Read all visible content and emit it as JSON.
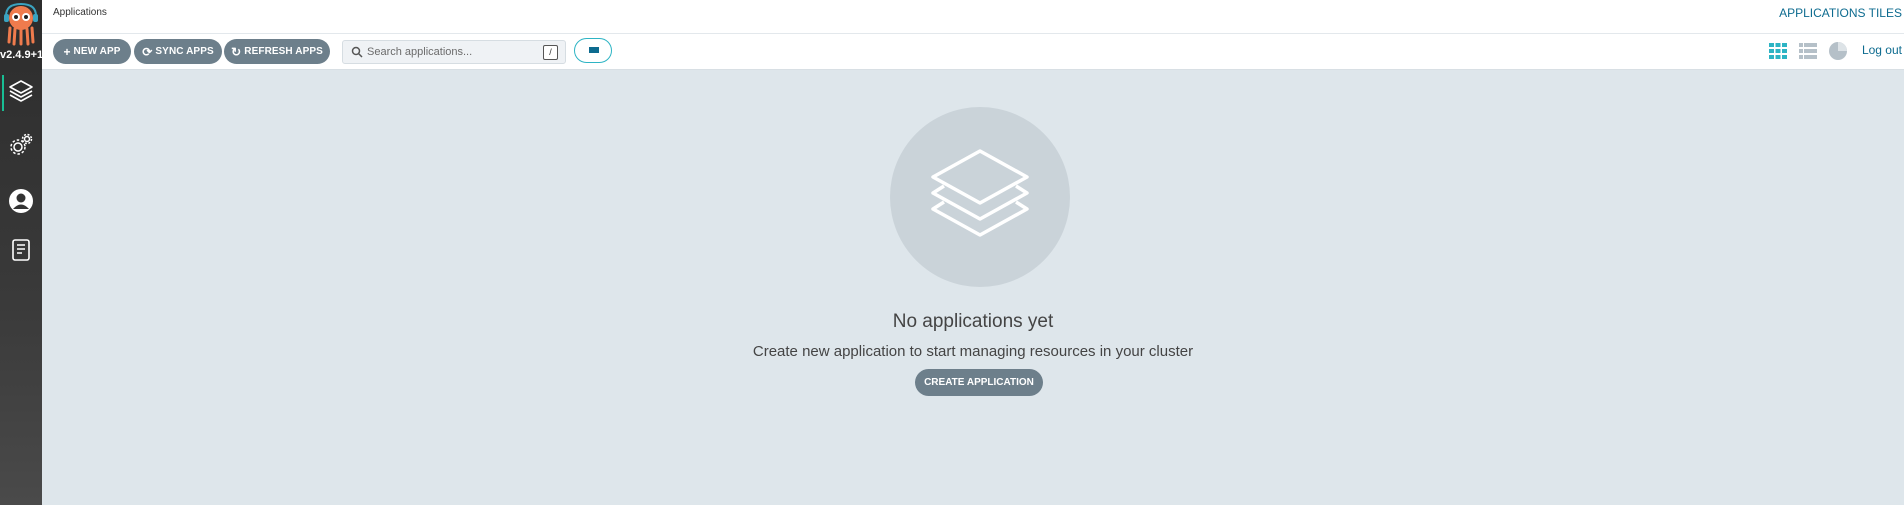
{
  "sidebar": {
    "version": "v2.4.9+1",
    "logo": "argo-octopus-logo",
    "items": [
      {
        "name": "applications",
        "icon": "layers-icon",
        "active": true
      },
      {
        "name": "settings",
        "icon": "gears-icon",
        "active": false
      },
      {
        "name": "user-info",
        "icon": "user-circle-icon",
        "active": false
      },
      {
        "name": "documentation",
        "icon": "book-icon",
        "active": false
      }
    ]
  },
  "topbar": {
    "breadcrumb": "Applications",
    "title": "APPLICATIONS TILES"
  },
  "toolbar": {
    "new_app": {
      "icon": "+",
      "label": "NEW APP"
    },
    "sync_apps": {
      "icon": "⟳",
      "label": "SYNC APPS"
    },
    "refresh_apps": {
      "icon": "↻",
      "label": "REFRESH APPS"
    },
    "search": {
      "placeholder": "Search applications...",
      "value": "",
      "shortcut": "/"
    },
    "views": [
      "tiles-view-icon",
      "list-view-icon",
      "summary-pie-icon"
    ],
    "logout": "Log out"
  },
  "empty_state": {
    "icon": "layers-icon",
    "title": "No applications yet",
    "description": "Create new application to start managing resources in your cluster",
    "button": "CREATE APPLICATION"
  },
  "colors": {
    "accent": "#2db4c4",
    "link": "#0d6b8f",
    "button": "#6d7f8b",
    "background": "#dee6eb",
    "active_indicator": "#18be94"
  }
}
